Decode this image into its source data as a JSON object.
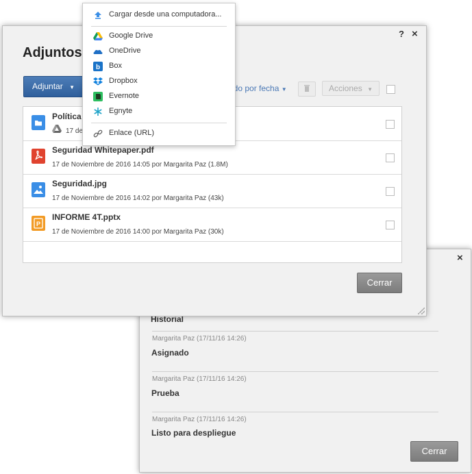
{
  "history_dialog": {
    "close": "×",
    "section_title": "Historial",
    "entries": [
      {
        "meta": "Margarita Paz (17/11/16 14:26)",
        "title": "Asignado"
      },
      {
        "meta": "Margarita Paz (17/11/16 14:26)",
        "title": "Prueba"
      },
      {
        "meta": "Margarita Paz (17/11/16 14:26)",
        "title": "Listo para despliegue"
      }
    ],
    "close_button": "Cerrar"
  },
  "attachments_dialog": {
    "title": "Adjuntos (",
    "help": "?",
    "close": "×",
    "attach_button": "Adjuntar",
    "sort_link": "ado por fecha",
    "actions_button": "Acciones",
    "files": [
      {
        "name": "Política d",
        "meta": "17 de",
        "icon": "folder-icon",
        "color": "#3a8ee6"
      },
      {
        "name": "Seguridad Whitepaper.pdf",
        "meta": "17 de Noviembre de 2016 14:05 por Margarita Paz (1.8M)",
        "icon": "pdf-icon",
        "color": "#e0432f"
      },
      {
        "name": "Seguridad.jpg",
        "meta": "17 de Noviembre de 2016 14:02 por Margarita Paz (43k)",
        "icon": "image-icon",
        "color": "#3a8ee6"
      },
      {
        "name": "INFORME 4T.pptx",
        "meta": "17 de Noviembre de 2016 14:00 por Margarita Paz (30k)",
        "icon": "pptx-icon",
        "color": "#f29b26"
      }
    ],
    "close_button": "Cerrar"
  },
  "upload_menu": {
    "items": [
      {
        "label": "Cargar desde una computadora...",
        "icon": "upload-icon"
      },
      {
        "label": "Google Drive",
        "icon": "google-drive-icon"
      },
      {
        "label": "OneDrive",
        "icon": "onedrive-icon"
      },
      {
        "label": "Box",
        "icon": "box-icon"
      },
      {
        "label": "Dropbox",
        "icon": "dropbox-icon"
      },
      {
        "label": "Evernote",
        "icon": "evernote-icon"
      },
      {
        "label": "Egnyte",
        "icon": "egnyte-icon"
      },
      {
        "label": "Enlace (URL)",
        "icon": "link-icon"
      }
    ]
  }
}
